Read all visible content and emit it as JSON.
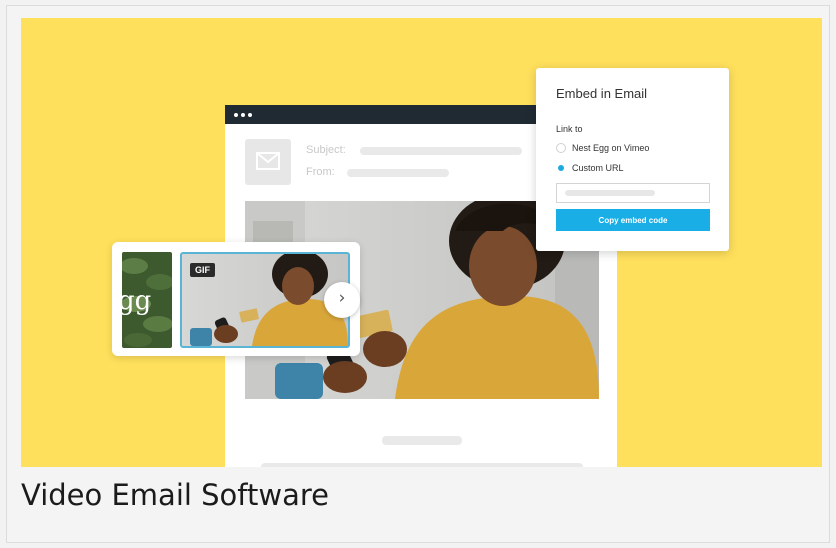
{
  "email": {
    "subject_label": "Subject:",
    "from_label": "From:"
  },
  "gallery": {
    "gif_badge": "GIF",
    "logo_fragment": "gg",
    "next_glyph": "›"
  },
  "embed_panel": {
    "title": "Embed in Email",
    "link_to_label": "Link to",
    "options": [
      {
        "label": "Nest Egg on Vimeo",
        "selected": false
      },
      {
        "label": "Custom URL",
        "selected": true
      }
    ],
    "copy_button": "Copy embed code"
  },
  "caption": "Video Email Software",
  "colors": {
    "hero_background": "#ffe05c",
    "accent": "#1aaee6",
    "window_bar": "#1f2a33"
  }
}
